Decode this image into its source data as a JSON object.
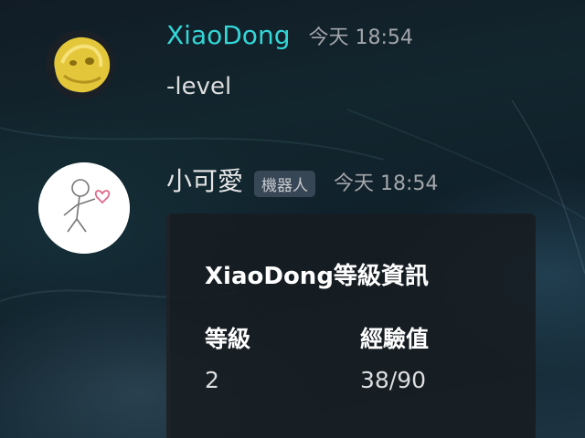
{
  "messages": [
    {
      "username": "XiaoDong",
      "username_color": "#33d6d6",
      "timestamp": "今天 18:54",
      "avatar_icon": "yellow-blob-avatar-icon",
      "content": "-level"
    },
    {
      "username": "小可愛",
      "username_color": "#e6e6e6",
      "bot_tag": "機器人",
      "timestamp": "今天 18:54",
      "avatar_icon": "stick-figure-heart-avatar-icon",
      "embed": {
        "title": "XiaoDong等級資訊",
        "fields": [
          {
            "name": "等級",
            "value": "2"
          },
          {
            "name": "經驗值",
            "value": "38/90"
          }
        ]
      }
    }
  ]
}
